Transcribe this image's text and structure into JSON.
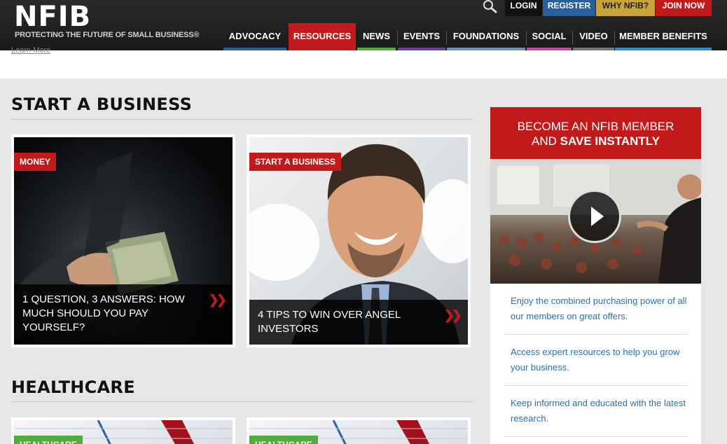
{
  "header": {
    "logo": "NFIB",
    "tagline": "PROTECTING THE FUTURE OF SMALL BUSINESS®",
    "utility": [
      "LOGIN",
      "REGISTER",
      "WHY NFIB?",
      "JOIN NOW"
    ],
    "nav": [
      {
        "label": "ADVOCACY",
        "color": "#2b5f9a"
      },
      {
        "label": "RESOURCES",
        "color": "#c21a1a"
      },
      {
        "label": "NEWS",
        "color": "#4fae3b"
      },
      {
        "label": "EVENTS",
        "color": "#6a3fa0"
      },
      {
        "label": "FOUNDATIONS",
        "color": "#6f93a8"
      },
      {
        "label": "SOCIAL",
        "color": "#d63f9c"
      },
      {
        "label": "VIDEO",
        "color": "#777777"
      },
      {
        "label": "MEMBER BENEFITS",
        "color": "#2a8fd0"
      }
    ]
  },
  "learn_more": "Learn More",
  "sections": [
    {
      "title": "START A BUSINESS",
      "cards": [
        {
          "tag": "MONEY",
          "caption": "1 QUESTION, 3 ANSWERS: HOW MUCH SHOULD YOU PAY YOURSELF?"
        },
        {
          "tag": "START A BUSINESS",
          "caption": "4 TIPS TO WIN OVER ANGEL INVESTORS"
        }
      ]
    },
    {
      "title": "HEALTHCARE",
      "cards": [
        {
          "tag": "HEALTHCARE"
        },
        {
          "tag": "HEALTHCARE"
        }
      ]
    }
  ],
  "sidebar": {
    "headline_line1": "BECOME AN NFIB MEMBER",
    "headline_and": "AND ",
    "headline_bold": "SAVE INSTANTLY",
    "benefits": [
      "Enjoy the combined purchasing power of all our members on great offers.",
      "Access expert resources to help you grow your business.",
      "Keep informed and educated with the latest research."
    ]
  },
  "colors": {
    "brand_red": "#c21a1a",
    "link_blue": "#2b6fb0",
    "tag_green": "#4fae3b"
  }
}
